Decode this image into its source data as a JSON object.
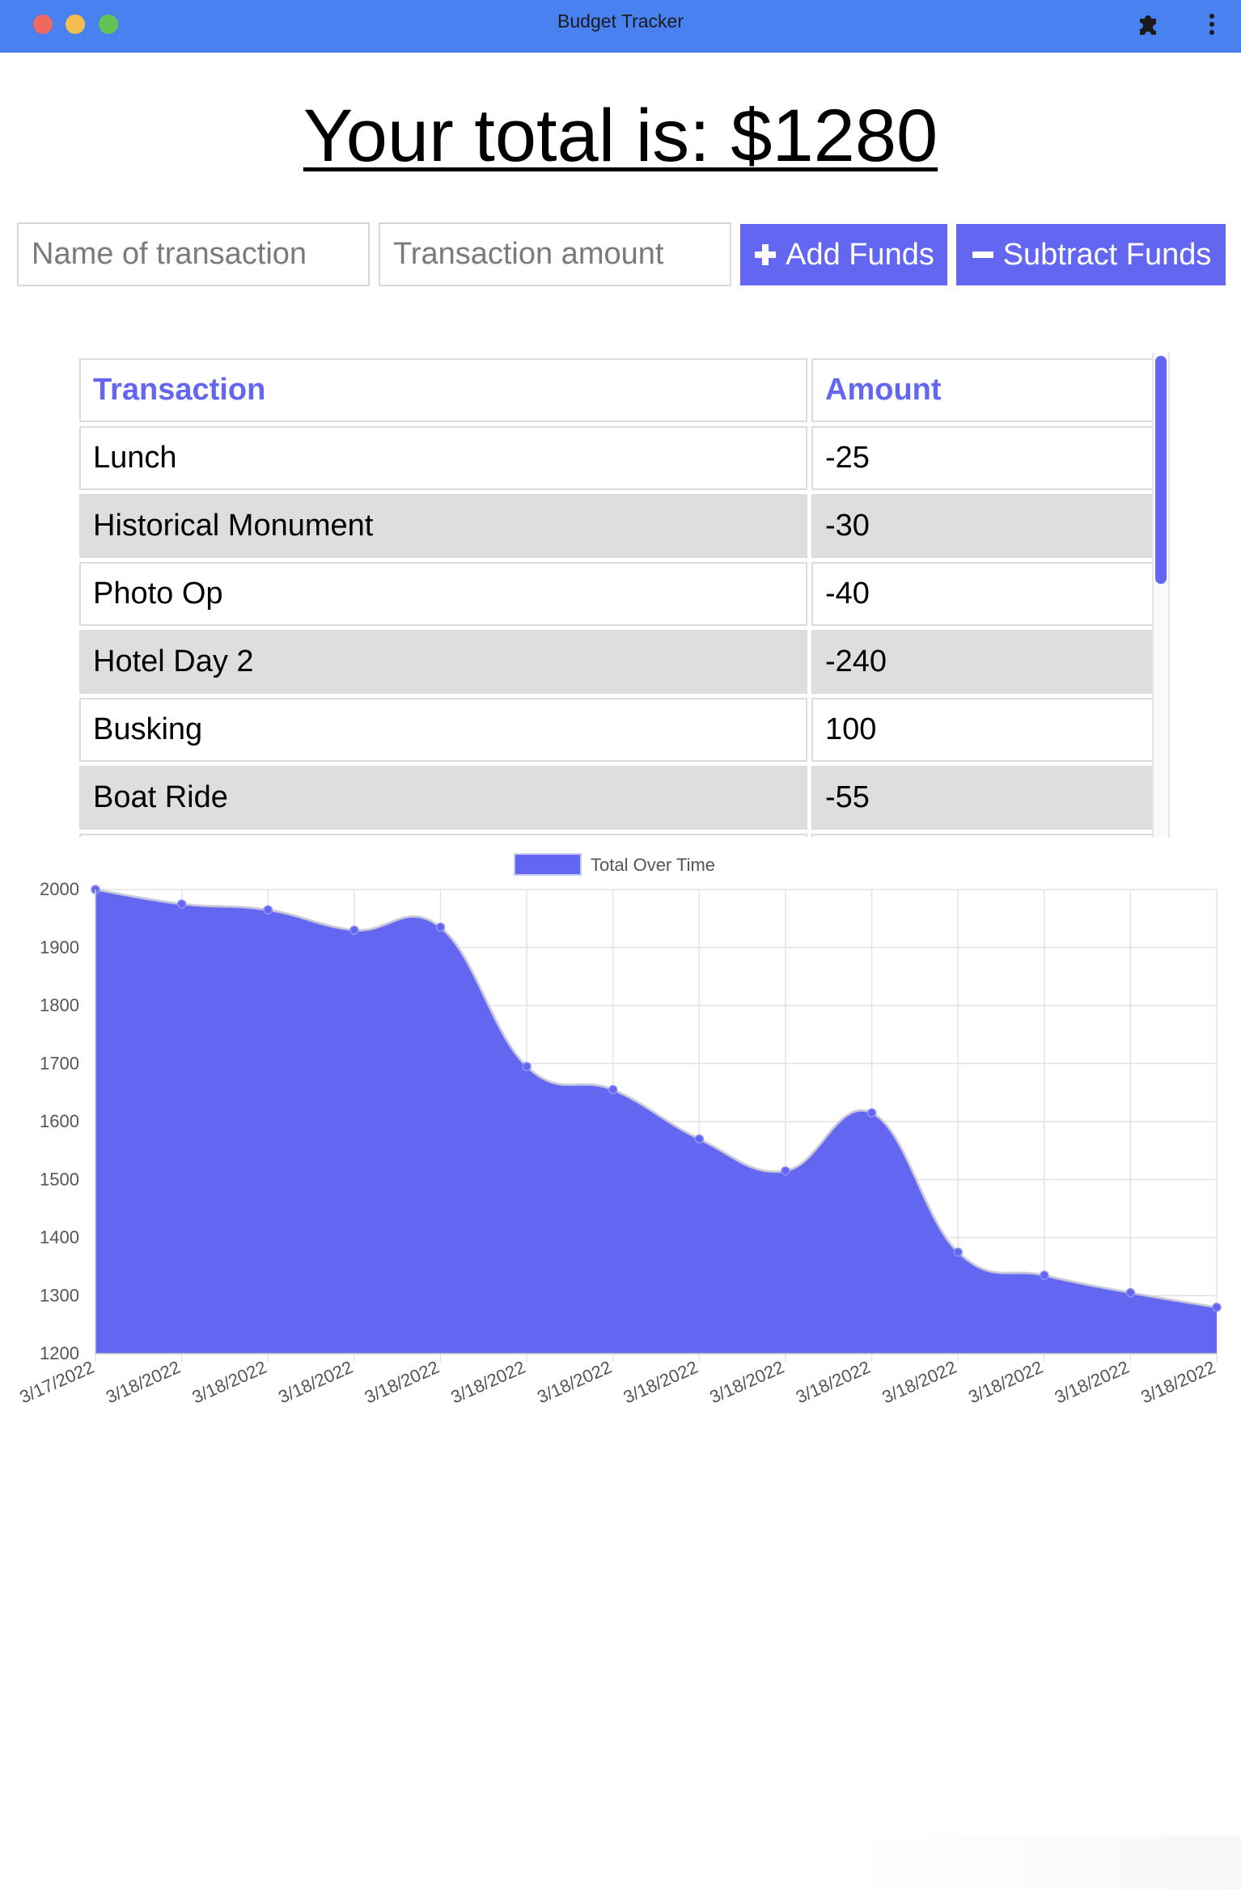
{
  "window": {
    "title": "Budget Tracker"
  },
  "total": {
    "label": "Your total is: $",
    "value": "1280"
  },
  "form": {
    "name_placeholder": "Name of transaction",
    "amount_placeholder": "Transaction amount",
    "add_label": "Add Funds",
    "subtract_label": "Subtract Funds"
  },
  "table": {
    "headers": [
      "Transaction",
      "Amount"
    ],
    "rows": [
      {
        "name": "Lunch",
        "amount": "-25"
      },
      {
        "name": "Historical Monument",
        "amount": "-30"
      },
      {
        "name": "Photo Op",
        "amount": "-40"
      },
      {
        "name": "Hotel Day 2",
        "amount": "-240"
      },
      {
        "name": "Busking",
        "amount": "100"
      },
      {
        "name": "Boat Ride",
        "amount": "-55"
      }
    ]
  },
  "colors": {
    "accent": "#6366f1",
    "titlebar": "#4a81f0"
  },
  "chart_data": {
    "type": "area",
    "x": [
      "3/17/2022",
      "3/18/2022",
      "3/18/2022",
      "3/18/2022",
      "3/18/2022",
      "3/18/2022",
      "3/18/2022",
      "3/18/2022",
      "3/18/2022",
      "3/18/2022",
      "3/18/2022",
      "3/18/2022",
      "3/18/2022",
      "3/18/2022"
    ],
    "series": [
      {
        "name": "Total Over Time",
        "values": [
          2000,
          1975,
          1965,
          1930,
          1935,
          1695,
          1655,
          1570,
          1515,
          1615,
          1375,
          1335,
          1305,
          1280
        ],
        "color": "#6366f1"
      }
    ],
    "ylim": [
      1200,
      2000
    ],
    "yticks": [
      2000,
      1900,
      1800,
      1700,
      1600,
      1500,
      1400,
      1300,
      1200
    ],
    "grid": true,
    "legend": "top-center"
  }
}
